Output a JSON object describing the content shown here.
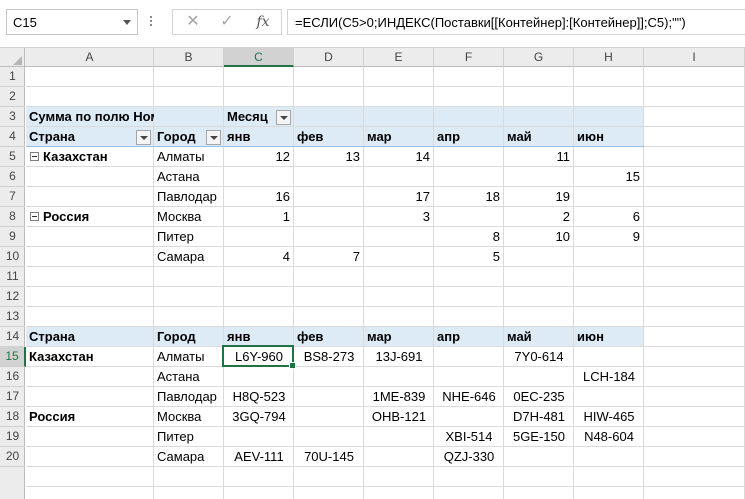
{
  "name_box": "C15",
  "formula": "=ЕСЛИ(C5>0;ИНДЕКС(Поставки[[Контейнер]:[Контейнер]];C5);\"\")",
  "formula_buttons": {
    "cancel": "✕",
    "enter": "✓",
    "fx": "fx"
  },
  "columns": [
    "A",
    "B",
    "C",
    "D",
    "E",
    "F",
    "G",
    "H",
    "I"
  ],
  "selected_column": "C",
  "rows": [
    "1",
    "2",
    "3",
    "4",
    "5",
    "6",
    "7",
    "8",
    "9",
    "10",
    "11",
    "12",
    "13",
    "14",
    "15",
    "16",
    "17",
    "18",
    "19",
    "20"
  ],
  "selected_row": "15",
  "pivot": {
    "title": "Сумма по полю Ном",
    "col_field": "Месяц",
    "row_field_1": "Страна",
    "row_field_2": "Город",
    "months": [
      "янв",
      "фев",
      "мар",
      "апр",
      "май",
      "июн"
    ],
    "groups": [
      {
        "country": "Казахстан",
        "rows": [
          {
            "city": "Алматы",
            "values": [
              "12",
              "13",
              "14",
              "",
              "11",
              ""
            ]
          },
          {
            "city": "Астана",
            "values": [
              "",
              "",
              "",
              "",
              "",
              "15"
            ]
          },
          {
            "city": "Павлодар",
            "values": [
              "16",
              "",
              "17",
              "18",
              "19",
              ""
            ]
          }
        ]
      },
      {
        "country": "Россия",
        "rows": [
          {
            "city": "Москва",
            "values": [
              "1",
              "",
              "3",
              "",
              "2",
              "6"
            ]
          },
          {
            "city": "Питер",
            "values": [
              "",
              "",
              "",
              "8",
              "10",
              "9"
            ]
          },
          {
            "city": "Самара",
            "values": [
              "4",
              "7",
              "",
              "5",
              "",
              ""
            ]
          }
        ]
      }
    ]
  },
  "result": {
    "header_country": "Страна",
    "header_city": "Город",
    "months": [
      "янв",
      "фев",
      "мар",
      "апр",
      "май",
      "июн"
    ],
    "rows": [
      {
        "country": "Казахстан",
        "city": "Алматы",
        "values": [
          "L6Y-960",
          "BS8-273",
          "13J-691",
          "",
          "7Y0-614",
          ""
        ]
      },
      {
        "country": "",
        "city": "Астана",
        "values": [
          "",
          "",
          "",
          "",
          "",
          "LCH-184"
        ]
      },
      {
        "country": "",
        "city": "Павлодар",
        "values": [
          "H8Q-523",
          "",
          "1ME-839",
          "NHE-646",
          "0EC-235",
          ""
        ]
      },
      {
        "country": "Россия",
        "city": "Москва",
        "values": [
          "3GQ-794",
          "",
          "OHB-121",
          "",
          "D7H-481",
          "HIW-465"
        ]
      },
      {
        "country": "",
        "city": "Питер",
        "values": [
          "",
          "",
          "",
          "XBI-514",
          "5GE-150",
          "N48-604"
        ]
      },
      {
        "country": "",
        "city": "Самара",
        "values": [
          "AEV-111",
          "70U-145",
          "",
          "QZJ-330",
          "",
          ""
        ]
      }
    ]
  },
  "colors": {
    "pivot_band": "#ddebf7",
    "selection": "#217346",
    "gridline": "#dadada"
  }
}
